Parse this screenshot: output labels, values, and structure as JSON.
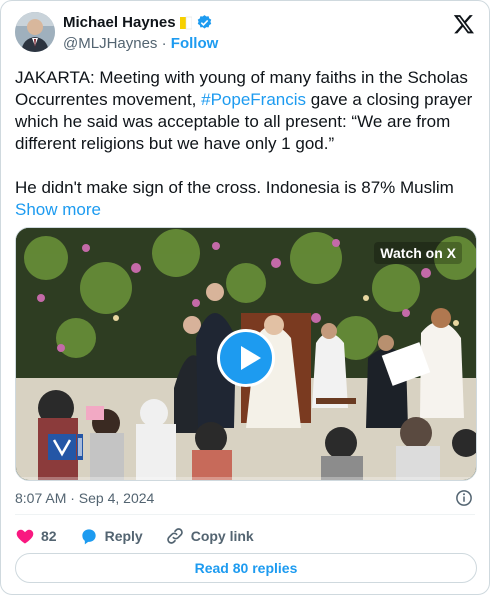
{
  "author": {
    "name": "Michael Haynes",
    "handle": "@MLJHaynes",
    "separator": "·",
    "follow_label": "Follow"
  },
  "tweet": {
    "text_part1": "JAKARTA: Meeting with young of many faiths in the Scholas Occurrentes movement, ",
    "hashtag": "#PopeFrancis",
    "text_part2": " gave a closing prayer which he said was acceptable to all present: “We are from different religions but we have only 1 god.”\n\nHe didn't make sign of the cross. Indonesia is 87% Muslim ",
    "show_more": "Show more"
  },
  "media": {
    "watch_label": "Watch on X",
    "progress": 0
  },
  "timestamp": "8:07 AM · Sep 4, 2024",
  "actions": {
    "likes_count": "82",
    "reply_label": "Reply",
    "copy_link_label": "Copy link"
  },
  "read_replies_label": "Read 80 replies",
  "colors": {
    "accent": "#1d9bf0",
    "like": "#f91880",
    "text": "#0f1419",
    "muted": "#536471"
  },
  "icons": [
    "avatar",
    "vatican-flag-icon",
    "verified-badge-icon",
    "x-logo-icon",
    "play-icon",
    "info-icon",
    "heart-icon",
    "reply-bubble-icon",
    "link-icon"
  ]
}
